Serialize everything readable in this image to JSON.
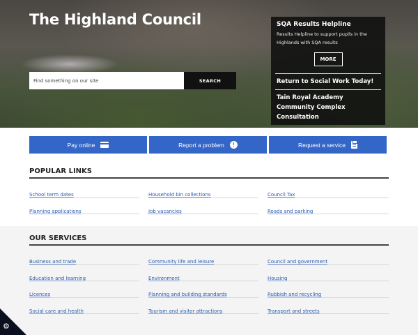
{
  "site_title": "The Highland Council",
  "search": {
    "placeholder": "Find something on our site",
    "button_label": "SEARCH"
  },
  "news": {
    "title": "SQA Results Helpline",
    "description": "Results Helpline to support pupils in the Highlands with SQA results",
    "more_label": "MORE",
    "links": [
      "Return to Social Work Today!",
      "Tain Royal Academy Community Complex Consultation"
    ]
  },
  "actions": [
    {
      "label": "Pay online",
      "icon": "card-icon"
    },
    {
      "label": "Report a problem",
      "icon": "alert-icon"
    },
    {
      "label": "Request a service",
      "icon": "clipboard-icon"
    }
  ],
  "popular_links": {
    "heading": "POPULAR LINKS",
    "items": [
      "School term dates",
      "Household bin collections",
      "Council Tax",
      "Planning applications",
      "Job vacancies",
      "Roads and parking"
    ]
  },
  "services": {
    "heading": "OUR SERVICES",
    "items": [
      "Business and trade",
      "Community life and leisure",
      "Council and government",
      "Education and learning",
      "Environment",
      "Housing",
      "Licences",
      "Planning and building standards",
      "Rubbish and recycling",
      "Social care and health",
      "Tourism and visitor attractions",
      "Transport and streets"
    ]
  },
  "cookie_settings_icon": "gear-icon",
  "colors": {
    "accent": "#3466c8",
    "link": "#2a5db0"
  }
}
